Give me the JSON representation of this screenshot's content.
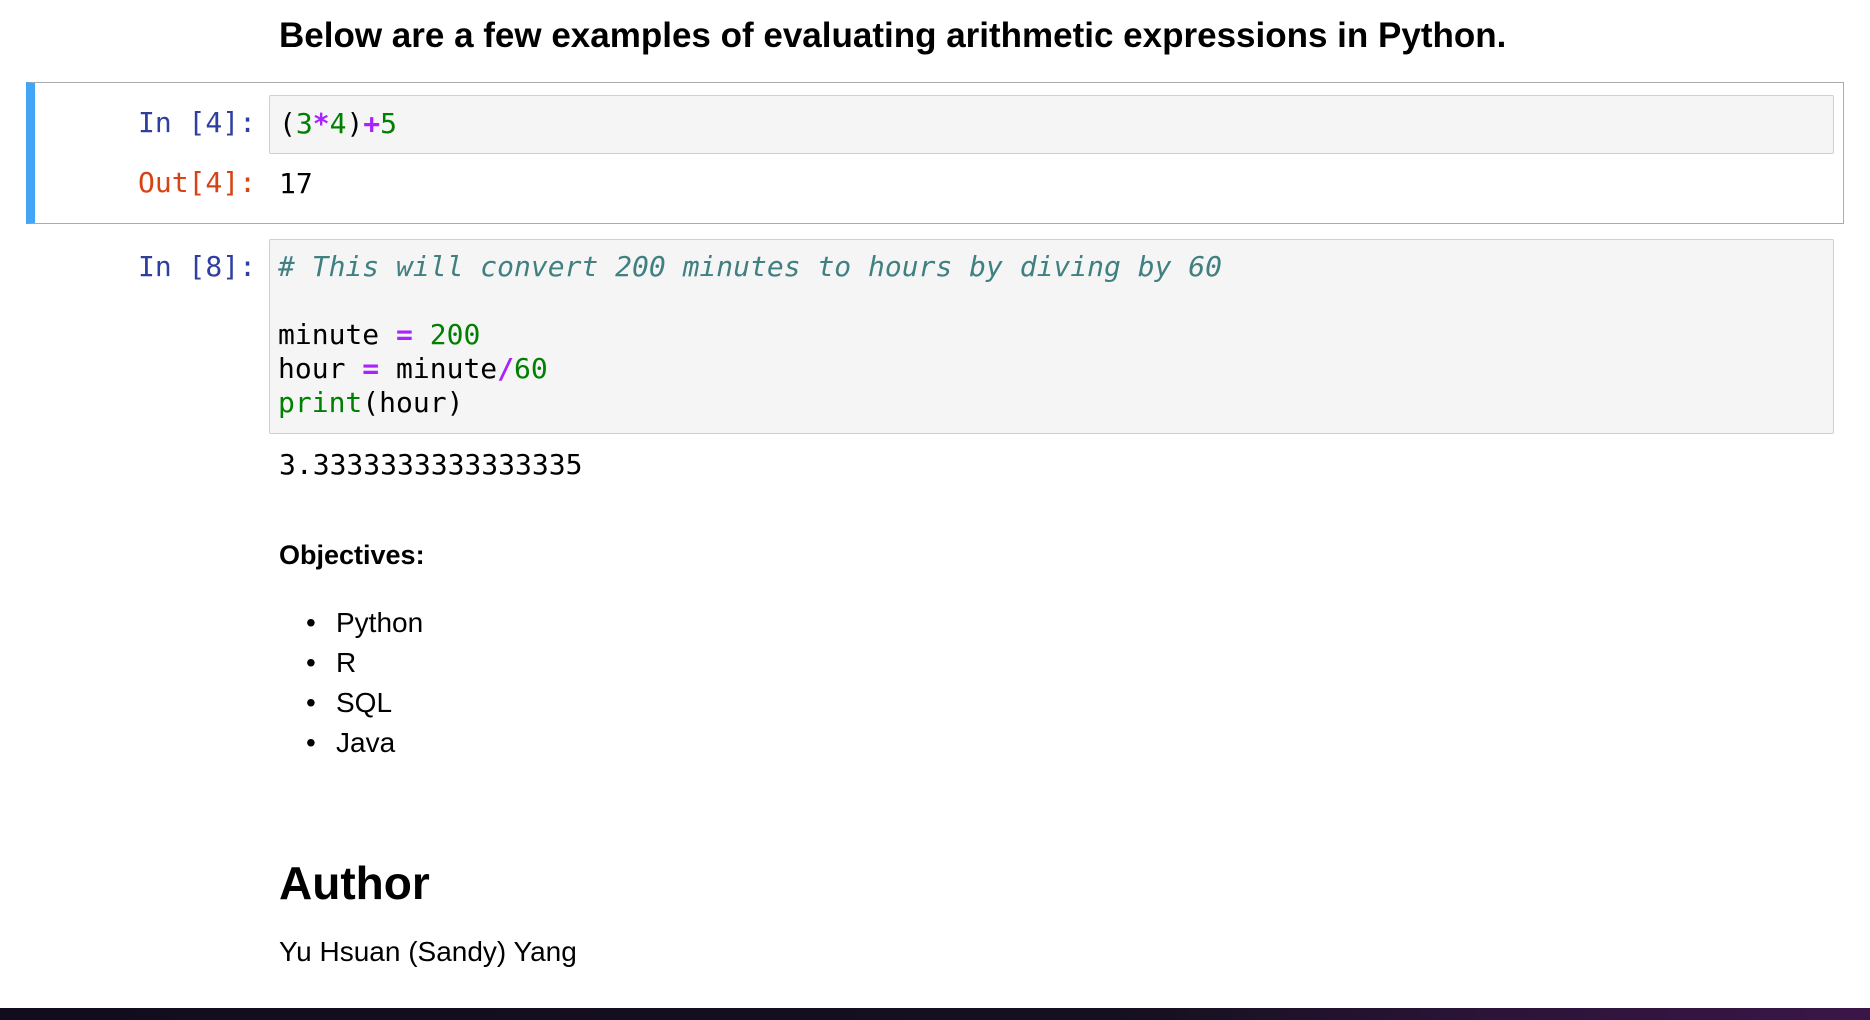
{
  "intro_heading": "Below are a few examples of evaluating arithmetic expressions in Python.",
  "cell1": {
    "in_prompt": "In [4]:",
    "out_prompt": "Out[4]:",
    "code": {
      "t1": "(",
      "t2": "3",
      "t3": "*",
      "t4": "4",
      "t5": ")",
      "t6": "+",
      "t7": "5"
    },
    "output": "17"
  },
  "cell2": {
    "in_prompt": "In [8]:",
    "comment": "# This will convert 200 minutes to hours by diving by 60",
    "line2": {
      "var": "minute ",
      "op": "=",
      "sp": " ",
      "num": "200"
    },
    "line3": {
      "var": "hour ",
      "op": "=",
      "mid": " minute",
      "op2": "/",
      "num": "60"
    },
    "line4": {
      "fn": "print",
      "args": "(hour)"
    },
    "output": "3.3333333333333335"
  },
  "objectives": {
    "heading": "Objectives:",
    "items": [
      "Python",
      "R",
      "SQL",
      "Java"
    ]
  },
  "author": {
    "heading": "Author",
    "name": "Yu Hsuan (Sandy) Yang"
  },
  "colors": {
    "selected_cell_accent": "#42a5f5",
    "in_prompt": "#303f9f",
    "out_prompt": "#d84315",
    "number": "#008000",
    "operator": "#aa22ff",
    "comment": "#408080"
  }
}
